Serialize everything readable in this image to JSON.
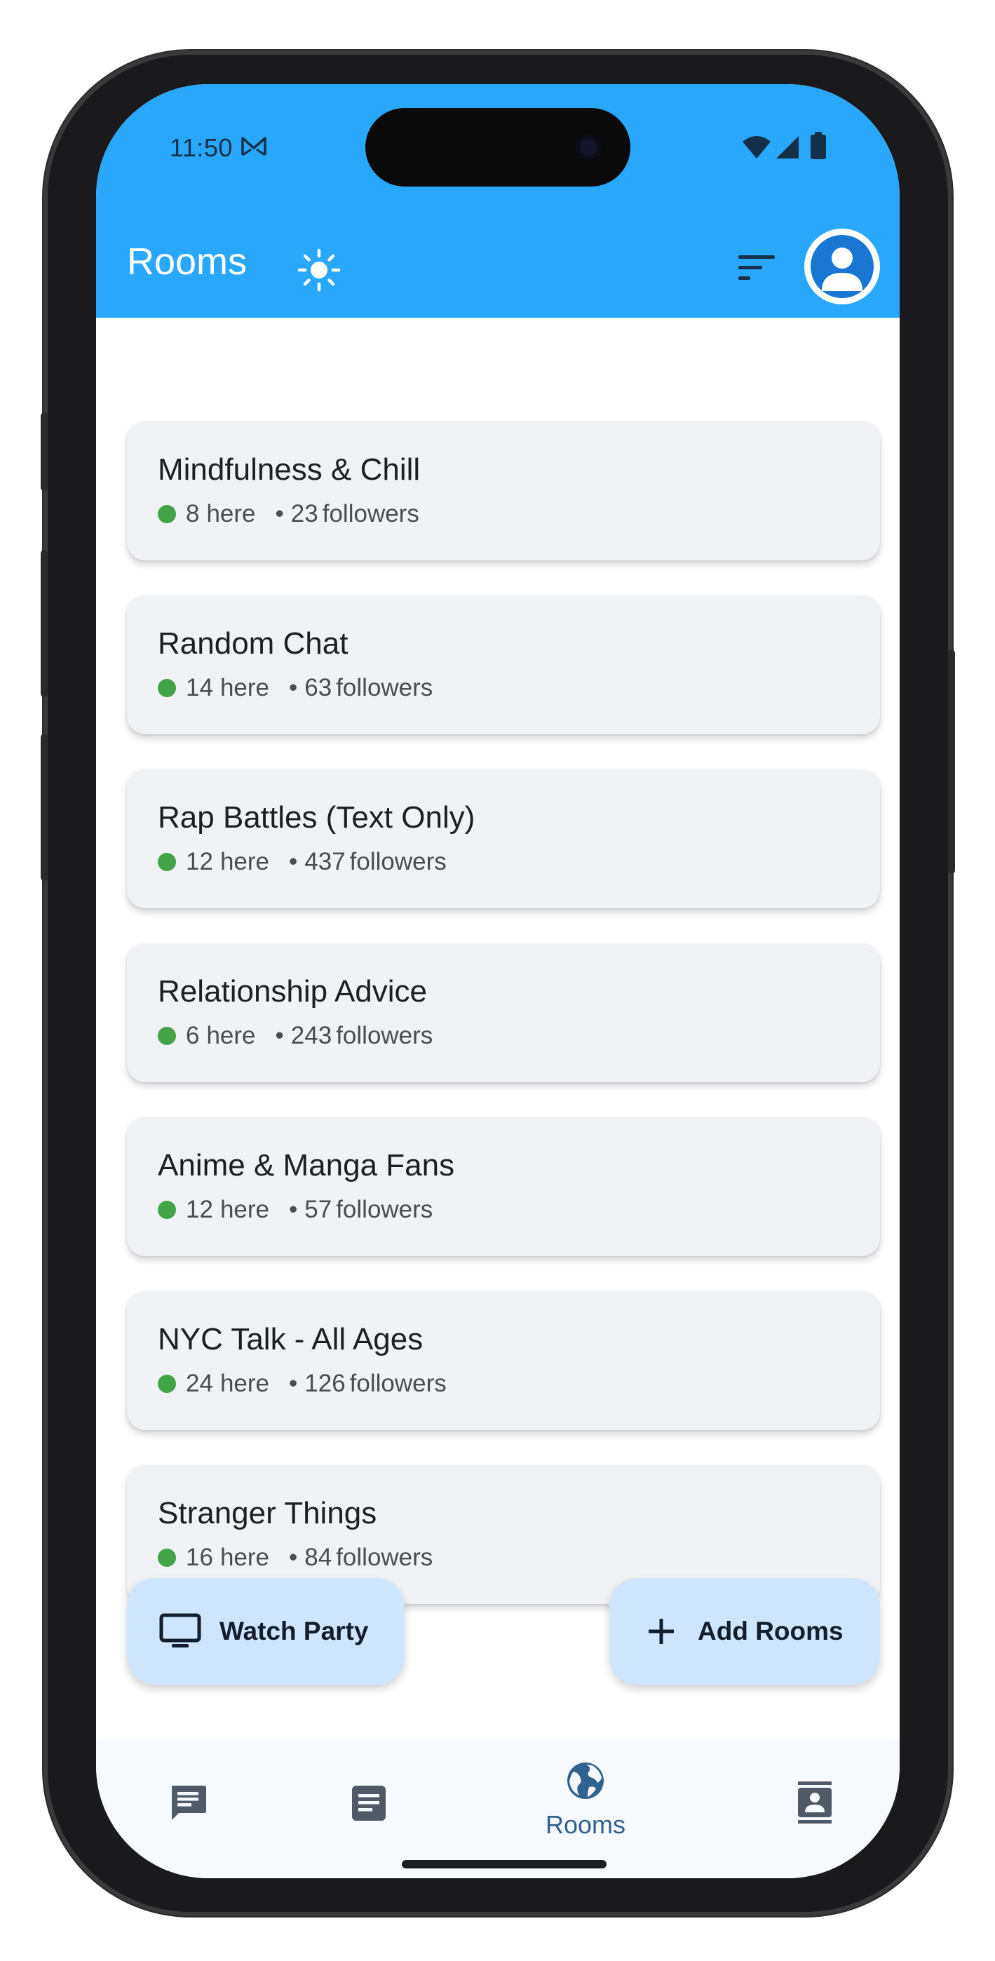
{
  "status_bar": {
    "time": "11:50"
  },
  "header": {
    "title": "Rooms"
  },
  "rooms": [
    {
      "name": "Mindfulness & Chill",
      "here": "8",
      "here_label": "here",
      "followers": "23",
      "followers_label": "followers"
    },
    {
      "name": "Random Chat",
      "here": "14",
      "here_label": "here",
      "followers": "63",
      "followers_label": "followers"
    },
    {
      "name": "Rap Battles (Text Only)",
      "here": "12",
      "here_label": "here",
      "followers": "437",
      "followers_label": "followers"
    },
    {
      "name": "Relationship Advice",
      "here": "6",
      "here_label": "here",
      "followers": "243",
      "followers_label": "followers"
    },
    {
      "name": "Anime & Manga Fans",
      "here": "12",
      "here_label": "here",
      "followers": "57",
      "followers_label": "followers"
    },
    {
      "name": "NYC Talk - All Ages",
      "here": "24",
      "here_label": "here",
      "followers": "126",
      "followers_label": "followers"
    },
    {
      "name": "Stranger Things",
      "here": "16",
      "here_label": "here",
      "followers": "84",
      "followers_label": "followers"
    }
  ],
  "fabs": {
    "watch_party": "Watch Party",
    "add_rooms": "Add Rooms"
  },
  "bottom_nav": {
    "rooms_label": "Rooms"
  },
  "icons": [
    "mail-icon",
    "wifi-icon",
    "signal-icon",
    "battery-icon",
    "sun-icon",
    "sort-icon",
    "profile-icon",
    "tv-icon",
    "plus-icon",
    "chat-icon",
    "notes-icon",
    "globe-icon",
    "contacts-icon"
  ],
  "colors": {
    "app_bar": "#28a7fb",
    "online_dot": "#43a447",
    "fab": "#cfe5fd",
    "nav_active": "#30628f",
    "card": "#f1f2f6"
  }
}
